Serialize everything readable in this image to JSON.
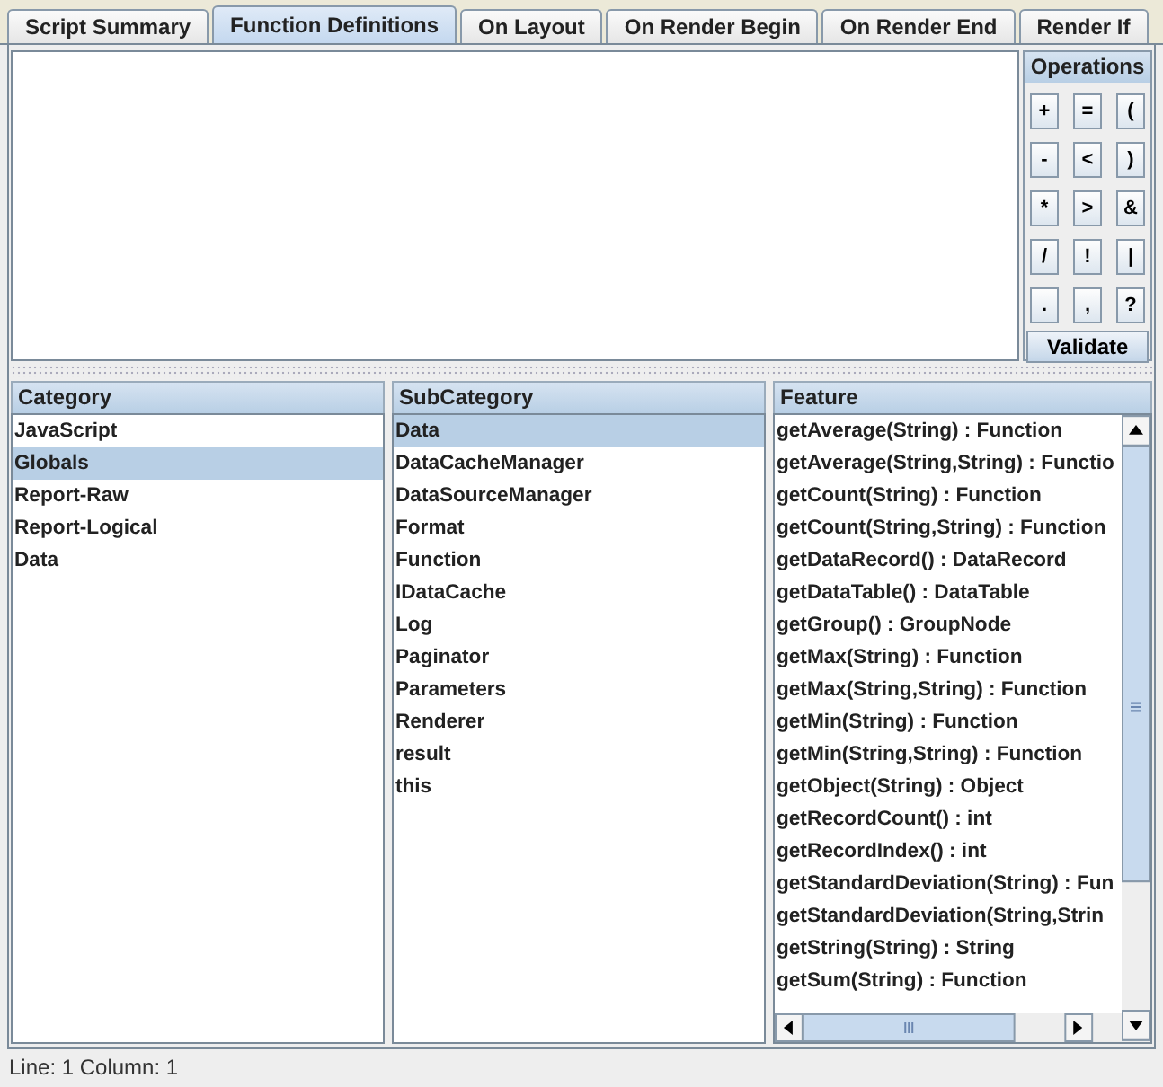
{
  "tabs": [
    {
      "label": "Script Summary",
      "selected": false
    },
    {
      "label": "Function Definitions",
      "selected": true
    },
    {
      "label": "On Layout",
      "selected": false
    },
    {
      "label": "On Render Begin",
      "selected": false
    },
    {
      "label": "On Render End",
      "selected": false
    },
    {
      "label": "Render If",
      "selected": false
    }
  ],
  "operations": {
    "title": "Operations",
    "keys": [
      "+",
      "=",
      "(",
      "-",
      "<",
      ")",
      "*",
      ">",
      "&",
      "/",
      "!",
      "|",
      ".",
      ",",
      "?"
    ],
    "validate": "Validate"
  },
  "lists": [
    {
      "header": "Category",
      "items": [
        {
          "label": "JavaScript",
          "selected": false
        },
        {
          "label": "Globals",
          "selected": true
        },
        {
          "label": "Report-Raw",
          "selected": false
        },
        {
          "label": "Report-Logical",
          "selected": false
        },
        {
          "label": "Data",
          "selected": false
        }
      ]
    },
    {
      "header": "SubCategory",
      "items": [
        {
          "label": "Data",
          "selected": true
        },
        {
          "label": "DataCacheManager",
          "selected": false
        },
        {
          "label": "DataSourceManager",
          "selected": false
        },
        {
          "label": "Format",
          "selected": false
        },
        {
          "label": "Function",
          "selected": false
        },
        {
          "label": "IDataCache",
          "selected": false
        },
        {
          "label": "Log",
          "selected": false
        },
        {
          "label": "Paginator",
          "selected": false
        },
        {
          "label": "Parameters",
          "selected": false
        },
        {
          "label": "Renderer",
          "selected": false
        },
        {
          "label": "result",
          "selected": false
        },
        {
          "label": "this",
          "selected": false
        }
      ]
    },
    {
      "header": "Feature",
      "items": [
        {
          "label": "getAverage(String) : Function",
          "selected": false
        },
        {
          "label": "getAverage(String,String) : Functio",
          "selected": false
        },
        {
          "label": "getCount(String) : Function",
          "selected": false
        },
        {
          "label": "getCount(String,String) : Function",
          "selected": false
        },
        {
          "label": "getDataRecord() : DataRecord",
          "selected": false
        },
        {
          "label": "getDataTable() : DataTable",
          "selected": false
        },
        {
          "label": "getGroup() : GroupNode",
          "selected": false
        },
        {
          "label": "getMax(String) : Function",
          "selected": false
        },
        {
          "label": "getMax(String,String) : Function",
          "selected": false
        },
        {
          "label": "getMin(String) : Function",
          "selected": false
        },
        {
          "label": "getMin(String,String) : Function",
          "selected": false
        },
        {
          "label": "getObject(String) : Object",
          "selected": false
        },
        {
          "label": "getRecordCount() : int",
          "selected": false
        },
        {
          "label": "getRecordIndex() : int",
          "selected": false
        },
        {
          "label": "getStandardDeviation(String) : Fun",
          "selected": false
        },
        {
          "label": "getStandardDeviation(String,Strin",
          "selected": false
        },
        {
          "label": "getString(String) : String",
          "selected": false
        },
        {
          "label": "getSum(String) : Function",
          "selected": false
        }
      ]
    }
  ],
  "status_bar": "Line: 1 Column: 1"
}
